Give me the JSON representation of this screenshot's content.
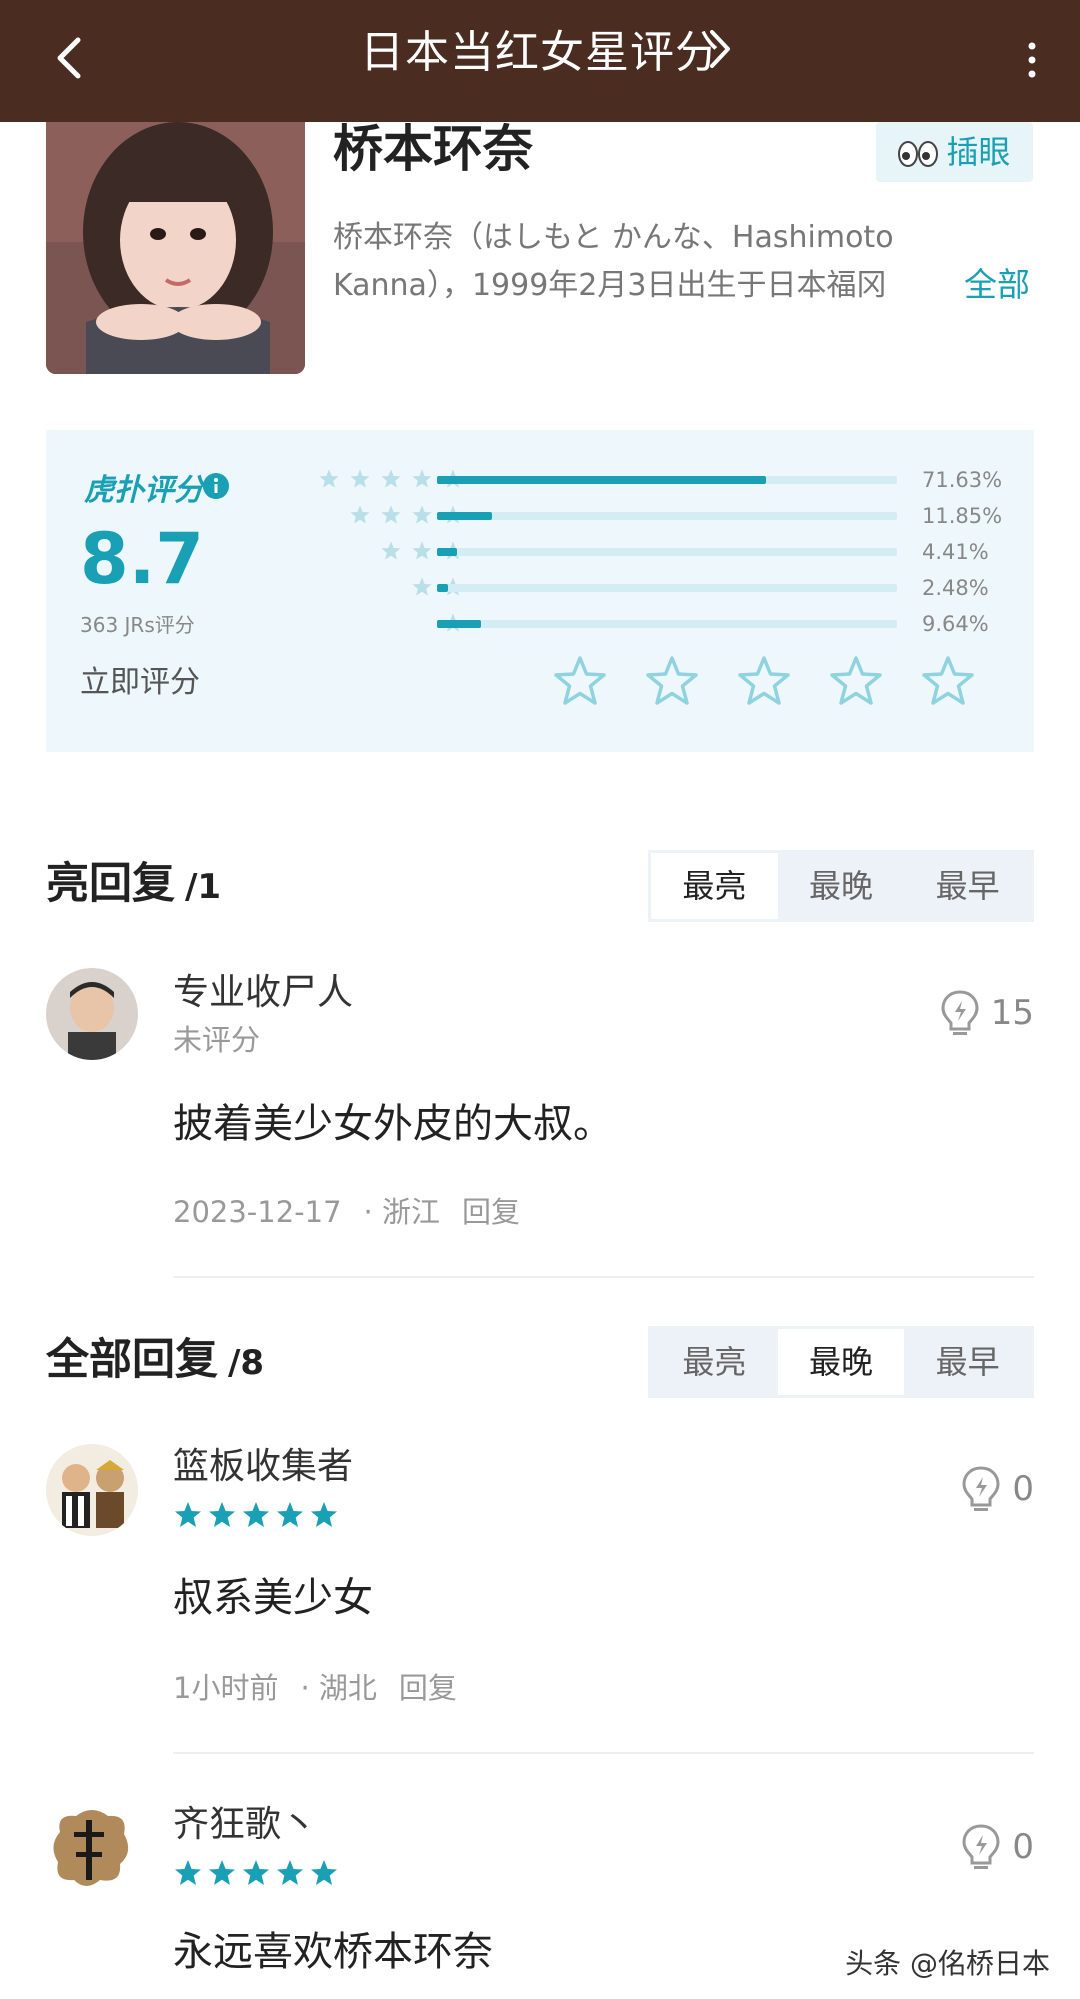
{
  "header": {
    "title": "日本当红女星评分",
    "colors": {
      "bar": "#4a2c21",
      "accent": "#19a0b4"
    }
  },
  "profile": {
    "name": "桥本环奈",
    "poke_label": "插眼",
    "desc_line1": "桥本环奈（はしもと かんな、Hashimoto",
    "desc_line2": "Kanna），1999年2月3日出生于日本福冈",
    "more_label": "全部"
  },
  "rating": {
    "brand": "虎扑评分",
    "score": "8.7",
    "votes": "363 JRs评分",
    "rate_now": "立即评分",
    "distribution": [
      {
        "stars": 5,
        "percent": 71.63,
        "label": "71.63%"
      },
      {
        "stars": 4,
        "percent": 11.85,
        "label": "11.85%"
      },
      {
        "stars": 3,
        "percent": 4.41,
        "label": "4.41%"
      },
      {
        "stars": 2,
        "percent": 2.48,
        "label": "2.48%"
      },
      {
        "stars": 1,
        "percent": 9.64,
        "label": "9.64%"
      }
    ]
  },
  "hot": {
    "title": "亮回复",
    "count": "/1",
    "tabs": [
      "最亮",
      "最晚",
      "最早"
    ],
    "active_tab": "最亮",
    "comments": [
      {
        "user": "专业收尸人",
        "status": "未评分",
        "text": "披着美少女外皮的大叔。",
        "date": "2023-12-17",
        "location": "· 浙江",
        "reply": "回复",
        "likes": "15"
      }
    ]
  },
  "all": {
    "title": "全部回复",
    "count": "/8",
    "tabs": [
      "最亮",
      "最晚",
      "最早"
    ],
    "active_tab": "最晚",
    "comments": [
      {
        "user": "篮板收集者",
        "stars": 5,
        "text": "叔系美少女",
        "date": "1小时前",
        "location": "· 湖北",
        "reply": "回复",
        "likes": "0"
      },
      {
        "user": "齐狂歌丶",
        "stars": 5,
        "text": "永远喜欢桥本环奈",
        "likes": "0"
      }
    ]
  },
  "watermark": "头条 @佲桥日本"
}
